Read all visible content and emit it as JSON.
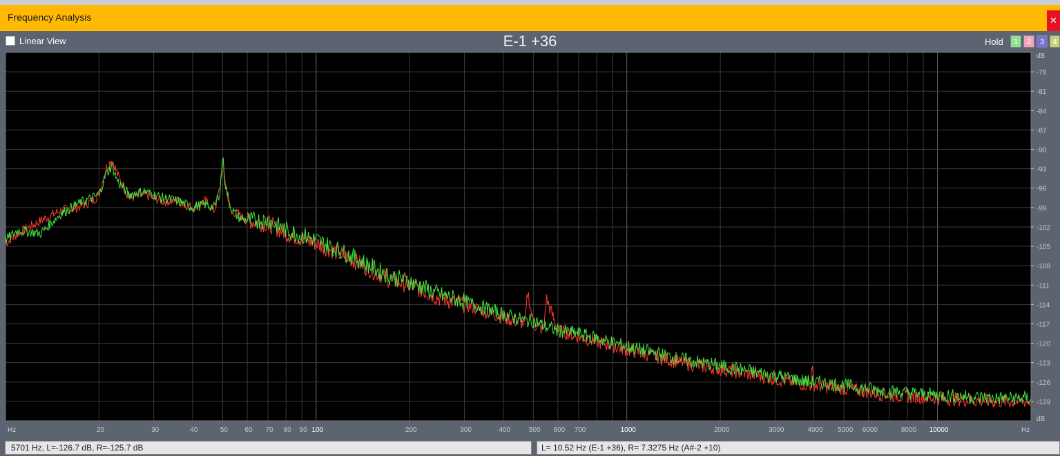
{
  "window": {
    "title": "Frequency Analysis",
    "close_glyph": "✕"
  },
  "toolbar": {
    "linear_view_label": "Linear View",
    "linear_view_checked": false,
    "note_display": "E-1 +36",
    "hold_label": "Hold",
    "hold_buttons": [
      "1",
      "2",
      "3",
      "4"
    ],
    "hold_colors": [
      "#8fe08f",
      "#f4a3b8",
      "#7b72d4",
      "#c9d07a"
    ]
  },
  "status": {
    "left": "5701 Hz, L=-126.7 dB, R=-125.7 dB",
    "right": "L=  10.52 Hz (E-1 +36), R= 7.3275 Hz (A#-2 +10)"
  },
  "colors": {
    "plot_bg": "#000000",
    "grid": "#3b3b3b",
    "left_channel": "#ff3b30",
    "right_channel": "#43e643",
    "axis_text": "#c8c8c8"
  },
  "chart_data": {
    "type": "line",
    "x_scale": "log",
    "xlim": [
      10,
      20000
    ],
    "ylim": [
      -132,
      -75
    ],
    "x_unit": "Hz",
    "y_unit": "dB",
    "x_tick_labels": [
      {
        "value": 20,
        "label": "20"
      },
      {
        "value": 30,
        "label": "30"
      },
      {
        "value": 40,
        "label": "40"
      },
      {
        "value": 50,
        "label": "50"
      },
      {
        "value": 60,
        "label": "60"
      },
      {
        "value": 70,
        "label": "70"
      },
      {
        "value": 80,
        "label": "80"
      },
      {
        "value": 90,
        "label": "90"
      },
      {
        "value": 100,
        "label": "100"
      },
      {
        "value": 200,
        "label": "200"
      },
      {
        "value": 300,
        "label": "300"
      },
      {
        "value": 400,
        "label": "400"
      },
      {
        "value": 500,
        "label": "500"
      },
      {
        "value": 600,
        "label": "600"
      },
      {
        "value": 700,
        "label": "700"
      },
      {
        "value": 1000,
        "label": "1000"
      },
      {
        "value": 2000,
        "label": "2000"
      },
      {
        "value": 3000,
        "label": "3000"
      },
      {
        "value": 4000,
        "label": "4000"
      },
      {
        "value": 5000,
        "label": "5000"
      },
      {
        "value": 6000,
        "label": "6000"
      },
      {
        "value": 8000,
        "label": "8000"
      },
      {
        "value": 10000,
        "label": "10000"
      }
    ],
    "y_tick_labels": [
      "-78",
      "-81",
      "-84",
      "-87",
      "-90",
      "-93",
      "-96",
      "-99",
      "-102",
      "-105",
      "-108",
      "-111",
      "-114",
      "-117",
      "-120",
      "-123",
      "-126",
      "-129"
    ],
    "series": [
      {
        "color": "#ff3b30",
        "x": [
          10,
          11,
          13,
          15,
          17,
          19,
          20,
          21,
          22,
          23,
          25,
          28,
          32,
          36,
          40,
          44,
          47,
          49,
          50,
          51,
          53,
          56,
          60,
          70,
          80,
          100,
          130,
          170,
          200,
          250,
          300,
          400,
          470,
          480,
          500,
          540,
          550,
          600,
          700,
          1000,
          1500,
          2000,
          3000,
          3900,
          3950,
          4000,
          5000,
          7000,
          10000,
          15000,
          20000
        ],
        "y": [
          -104.5,
          -103,
          -101,
          -99.5,
          -99,
          -98,
          -97,
          -93,
          -91.5,
          -94,
          -97.5,
          -97,
          -98,
          -98,
          -99,
          -98,
          -99.5,
          -96,
          -92,
          -95,
          -99.5,
          -100,
          -101,
          -101.5,
          -103,
          -104.5,
          -107,
          -110,
          -111,
          -113,
          -114,
          -116,
          -117,
          -112,
          -117,
          -118,
          -113,
          -118,
          -119,
          -121,
          -123,
          -124,
          -125.5,
          -126.5,
          -124,
          -126.5,
          -127,
          -128,
          -128.5,
          -129,
          -129
        ]
      },
      {
        "color": "#43e643",
        "x": [
          10,
          11,
          13,
          15,
          17,
          19,
          20,
          21,
          22,
          23,
          25,
          28,
          32,
          36,
          40,
          44,
          47,
          49,
          50,
          51,
          53,
          56,
          60,
          70,
          80,
          100,
          130,
          170,
          200,
          250,
          300,
          400,
          470,
          500,
          550,
          600,
          700,
          1000,
          1500,
          2000,
          3000,
          3900,
          4000,
          5000,
          7000,
          10000,
          15000,
          20000
        ],
        "y": [
          -104,
          -102.5,
          -103,
          -100,
          -98.5,
          -97.5,
          -97,
          -94,
          -92.5,
          -95,
          -97,
          -96.5,
          -97.5,
          -98,
          -99,
          -98.5,
          -99,
          -96.5,
          -91,
          -95.5,
          -99,
          -100.5,
          -101,
          -101,
          -102.5,
          -104,
          -106.5,
          -109.5,
          -110.5,
          -112.5,
          -113.5,
          -115.5,
          -116.5,
          -116.5,
          -117.5,
          -118,
          -118.5,
          -120.5,
          -122.5,
          -123.5,
          -125,
          -126,
          -126,
          -126.5,
          -127.5,
          -128,
          -128.5,
          -128.5
        ]
      }
    ]
  }
}
